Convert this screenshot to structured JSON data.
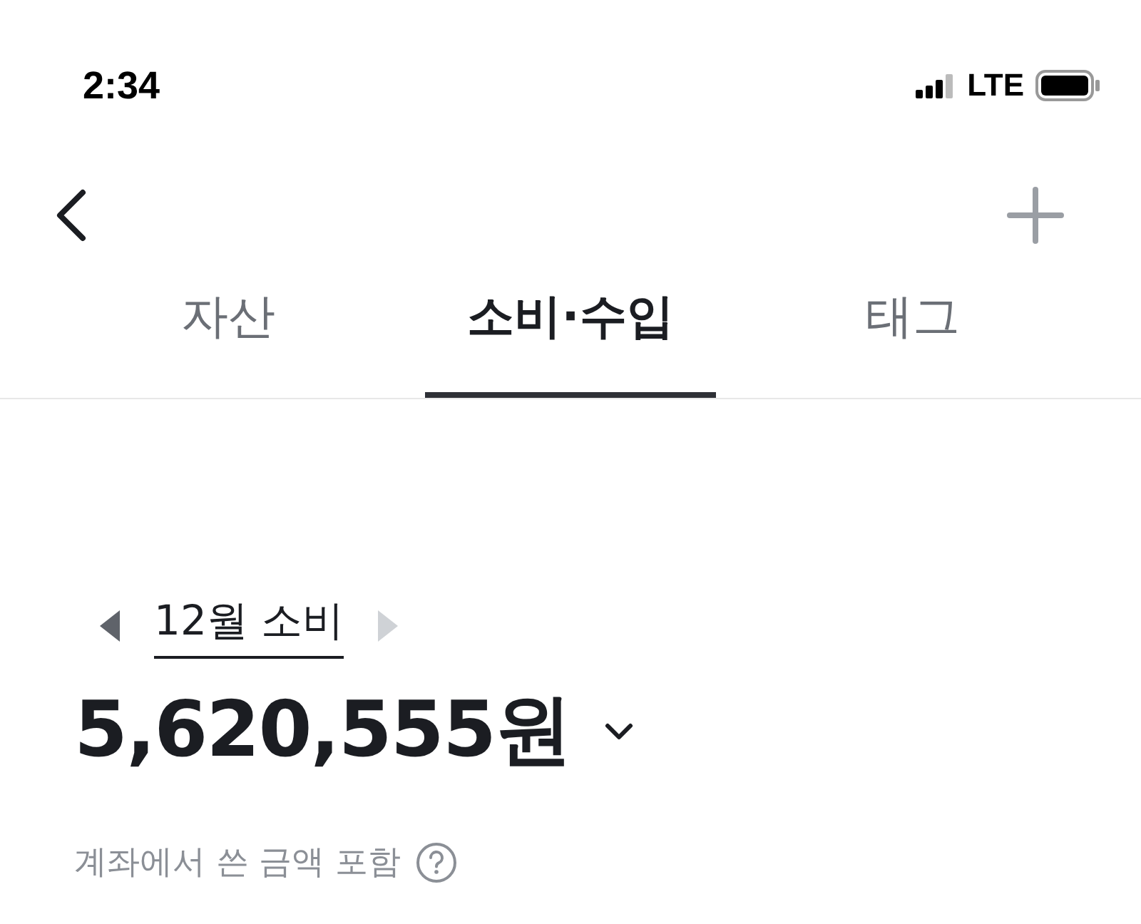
{
  "status_bar": {
    "time": "2:34",
    "network": "LTE"
  },
  "tabs": [
    {
      "label": "자산",
      "selected": false
    },
    {
      "label": "소비·수입",
      "selected": true
    },
    {
      "label": "태그",
      "selected": false
    }
  ],
  "month_nav": {
    "label": "12월 소비",
    "prev_disabled": false,
    "next_disabled": true
  },
  "amount": "5,620,555원",
  "note": "계좌에서 쓴 금액 포함"
}
